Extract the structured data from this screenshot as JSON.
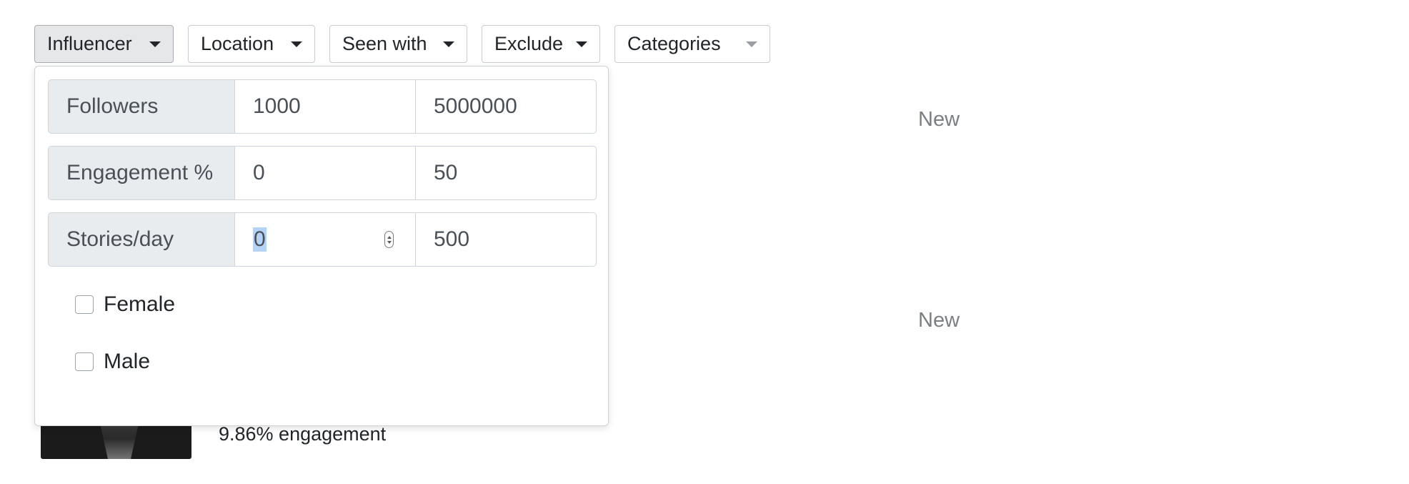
{
  "filters": {
    "influencer": "Influencer",
    "location": "Location",
    "seen_with": "Seen with",
    "exclude": "Exclude",
    "categories": "Categories"
  },
  "dropdown": {
    "followers": {
      "label": "Followers",
      "min": "1000",
      "max": "5000000"
    },
    "engagement": {
      "label": "Engagement %",
      "min": "0",
      "max": "50"
    },
    "stories": {
      "label": "Stories/day",
      "min": "0",
      "max": "500"
    },
    "gender": {
      "female": "Female",
      "male": "Male"
    }
  },
  "background": {
    "new_label_1": "New",
    "new_label_2": "New",
    "engagement_text": "9.86% engagement"
  }
}
